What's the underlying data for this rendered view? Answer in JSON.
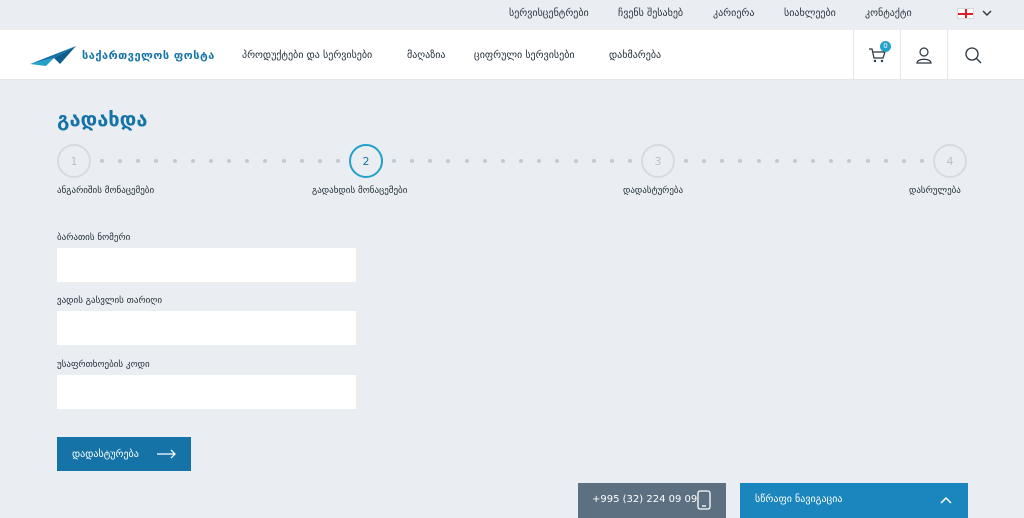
{
  "topbar": {
    "links": [
      "სერვისცენტრები",
      "ჩვენს შესახებ",
      "კარიერა",
      "სიახლეები",
      "კონტაქტი"
    ]
  },
  "header": {
    "logo_text": "საქართველოს ფოსტა",
    "nav": [
      "პროდუქტები და სერვისები",
      "მაღაზია",
      "ციფრული სერვისები",
      "დახმარება"
    ],
    "cart_count": "0"
  },
  "page": {
    "title": "გადახდა"
  },
  "steps": [
    {
      "number": "1",
      "label": "ანგარიშის მონაცემები",
      "active": false
    },
    {
      "number": "2",
      "label": "გადახდის მონაცემები",
      "active": true
    },
    {
      "number": "3",
      "label": "დადასტურება",
      "active": false
    },
    {
      "number": "4",
      "label": "დასრულება",
      "active": false
    }
  ],
  "form": {
    "card_number_label": "ბარათის ნომერი",
    "card_number_value": "",
    "expiry_label": "ვადის გასვლის თარიღი",
    "expiry_value": "",
    "cvv_label": "უსაფრთხოების კოდი",
    "cvv_value": "",
    "submit_label": "დადასტურება"
  },
  "footer": {
    "phone": "+995 (32) 224 09 09",
    "quick_nav_label": "სწრაფი ნავიგაცია"
  },
  "colors": {
    "brand_blue": "#1573a8",
    "accent_teal": "#22a2c8",
    "page_bg": "#eaeef2"
  }
}
